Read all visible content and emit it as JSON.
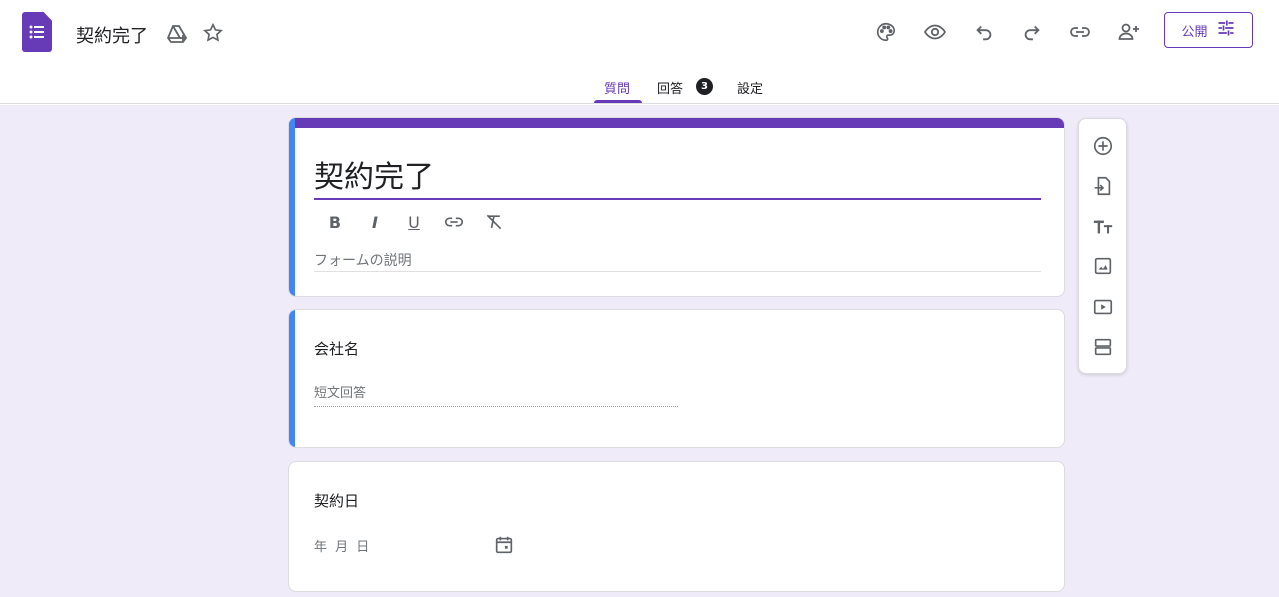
{
  "app": {
    "doc_title": "契約完了",
    "publish_label": "公開"
  },
  "tabs": [
    {
      "label": "質問",
      "active": true
    },
    {
      "label": "回答",
      "badge": "3"
    },
    {
      "label": "設定"
    }
  ],
  "form": {
    "title": "契約完了",
    "description_placeholder": "フォームの説明",
    "format_buttons": [
      "B",
      "I",
      "U"
    ]
  },
  "questions": [
    {
      "title": "会社名",
      "placeholder": "短文回答",
      "type": "short-answer"
    },
    {
      "title": "契約日",
      "placeholder": "年 月 日",
      "type": "date"
    }
  ],
  "colors": {
    "accent": "#673ab7",
    "canvas": "#f0ebf8",
    "active_stripe": "#4285f4"
  },
  "icons": {
    "topbar": [
      "add-to-drive-icon",
      "star-icon",
      "palette-icon",
      "preview-icon",
      "undo-icon",
      "redo-icon",
      "link-icon",
      "add-collaborator-icon",
      "tune-icon"
    ],
    "side_toolbar": [
      "add-question-icon",
      "import-questions-icon",
      "add-title-icon",
      "add-image-icon",
      "add-video-icon",
      "add-section-icon"
    ]
  }
}
